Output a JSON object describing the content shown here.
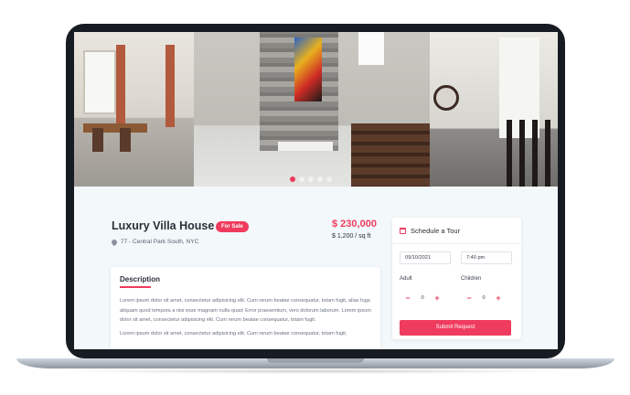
{
  "listing": {
    "title": "Luxury Villa House",
    "badge": "For Sale",
    "address": "77 - Central Park South, NYC",
    "price": "$ 230,000",
    "price_per_sqft": "$ 1,200 / sq ft"
  },
  "gallery": {
    "photo_names": [
      "dining-room-photo",
      "stone-wall-stairs-photo",
      "living-room-clock-photo"
    ],
    "dot_count": 5,
    "active_dot": 0
  },
  "description": {
    "heading": "Description",
    "paragraphs": [
      "Lorem ipsum dolor sit amet, consectetur adipisicing elit. Cum rerum beatae consequatur, totam fugit, alias fuga aliquam quod tempora a nisi esse magnam nulla quas! Error praesentium, vero dolorum laborum. Lorem ipsum dolor sit amet, consectetur adipisicing elit. Cum rerum beatae consequatur, totam fugit.",
      "Lorem ipsum dolor sit amet, consectetur adipisicing elit. Cum rerum beatae consequatur, totam fugit,"
    ]
  },
  "tour": {
    "heading": "Schedule a Tour",
    "date_value": "09/10/2021",
    "time_value": "7:40 pm",
    "adult_label": "Adult",
    "children_label": "Children",
    "adult_count": "0",
    "children_count": "0",
    "minus_symbol": "−",
    "plus_symbol": "+",
    "submit_label": "Submit Request"
  },
  "colors": {
    "accent": "#ef3b5d",
    "frame": "#171b22",
    "background": "#f3f8fb"
  }
}
